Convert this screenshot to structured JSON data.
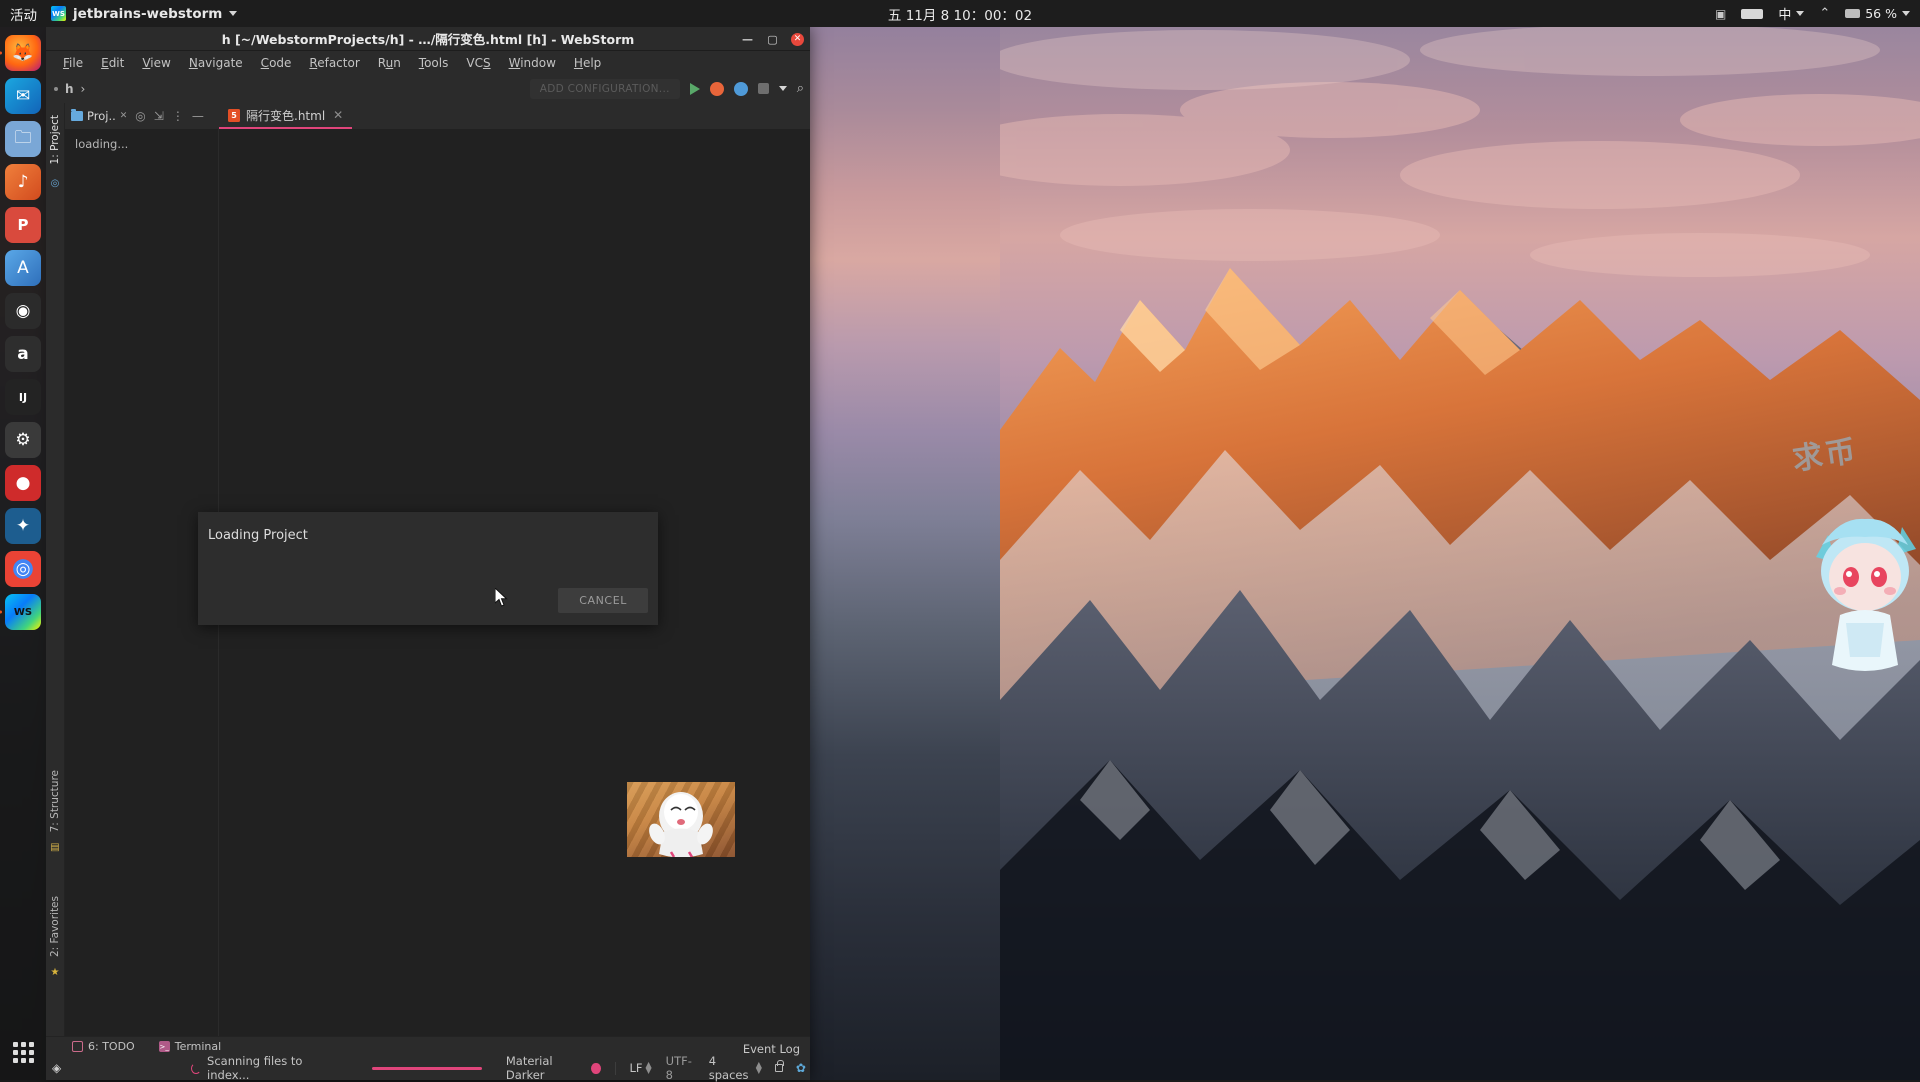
{
  "topbar": {
    "activities": "活动",
    "app_name": "jetbrains-webstorm",
    "app_icon": "webstorm-icon",
    "clock": "五 11月 8  10：00：02",
    "tray": [
      {
        "name": "screencast-icon",
        "glyph": "▣"
      },
      {
        "name": "battery-wide-icon",
        "glyph": "▬"
      },
      {
        "name": "input-method-indicator",
        "label": "中"
      },
      {
        "name": "wifi-icon",
        "glyph": "≋"
      },
      {
        "name": "battery-icon",
        "glyph": "▭"
      }
    ],
    "battery_percent": "56 %"
  },
  "dock": {
    "items": [
      {
        "name": "dock-firefox",
        "label": "Firefox",
        "glyph": "🦊",
        "color": "#ff7139",
        "running": false
      },
      {
        "name": "dock-thunderbird",
        "label": "Thunderbird",
        "glyph": "✉",
        "color": "#3a7bd5",
        "running": false
      },
      {
        "name": "dock-files",
        "label": "Files",
        "glyph": "🗄",
        "color": "#6d9fe0",
        "running": false
      },
      {
        "name": "dock-rhythmbox",
        "label": "Rhythmbox",
        "glyph": "♫",
        "color": "#e8734a",
        "running": false
      },
      {
        "name": "dock-impress",
        "label": "LibreOffice Impress",
        "glyph": "P",
        "color": "#d94a3d",
        "running": false
      },
      {
        "name": "dock-software",
        "label": "Ubuntu Software",
        "glyph": "A",
        "color": "#4a90d9",
        "running": false
      },
      {
        "name": "dock-help",
        "label": "Help",
        "glyph": "◉",
        "color": "#2d2d2d",
        "running": false
      },
      {
        "name": "dock-amazon",
        "label": "Amazon",
        "glyph": "a",
        "color": "#343434",
        "running": false
      },
      {
        "name": "dock-intellij",
        "label": "IntelliJ IDEA",
        "glyph": "IJ",
        "color": "#2b2b2b",
        "running": false
      },
      {
        "name": "dock-settings",
        "label": "Settings",
        "glyph": "⚙",
        "color": "#3c3c3c",
        "running": false
      },
      {
        "name": "dock-record",
        "label": "Recorder",
        "glyph": "●",
        "color": "#d62b2b",
        "running": false
      },
      {
        "name": "dock-vscode",
        "label": "Visual Studio Code",
        "glyph": "✦",
        "color": "#0e639c",
        "running": false
      },
      {
        "name": "dock-chrome",
        "label": "Google Chrome",
        "glyph": "◎",
        "color": "#f2f2f2",
        "running": false
      },
      {
        "name": "dock-webstorm",
        "label": "WebStorm",
        "glyph": "WS",
        "color": "#1c1c1c",
        "running": true
      }
    ]
  },
  "ide": {
    "title": "h [~/WebstormProjects/h] - …/隔行变色.html [h] - WebStorm",
    "window_buttons": {
      "minimize": "—",
      "maximize": "▢",
      "close": "✕"
    },
    "menu": [
      {
        "name": "menu-file",
        "label": "File",
        "mnemonic": "F"
      },
      {
        "name": "menu-edit",
        "label": "Edit",
        "mnemonic": "E"
      },
      {
        "name": "menu-view",
        "label": "View",
        "mnemonic": "V"
      },
      {
        "name": "menu-navigate",
        "label": "Navigate",
        "mnemonic": "N"
      },
      {
        "name": "menu-code",
        "label": "Code",
        "mnemonic": "C"
      },
      {
        "name": "menu-refactor",
        "label": "Refactor",
        "mnemonic": "R"
      },
      {
        "name": "menu-run",
        "label": "Run",
        "mnemonic": "u"
      },
      {
        "name": "menu-tools",
        "label": "Tools",
        "mnemonic": "T"
      },
      {
        "name": "menu-vcs",
        "label": "VCS",
        "mnemonic": "S"
      },
      {
        "name": "menu-window",
        "label": "Window",
        "mnemonic": "W"
      },
      {
        "name": "menu-help",
        "label": "Help",
        "mnemonic": "H"
      }
    ],
    "breadcrumb": "h",
    "breadcrumb_sep": "›",
    "add_configuration": "ADD CONFIGURATION...",
    "toolbar_icons": [
      {
        "name": "run-icon",
        "color": "#59a869"
      },
      {
        "name": "debug-icon",
        "color": "#e8653a"
      },
      {
        "name": "run-coverage-icon",
        "color": "#4f9ad8"
      },
      {
        "name": "stop-icon",
        "color": "#6e6e6e"
      },
      {
        "name": "chevron-down-icon",
        "color": "#b0b0b0"
      },
      {
        "name": "search-everywhere-icon",
        "color": "#b6b6b6"
      }
    ],
    "left_tabs": [
      {
        "name": "sidebar-tab-project",
        "label": "1: Project",
        "active": true
      },
      {
        "name": "sidebar-tab-structure",
        "label": "7: Structure",
        "active": false
      },
      {
        "name": "sidebar-tab-favorites",
        "label": "2: Favorites",
        "active": false
      }
    ],
    "project_panel": {
      "tab_label": "Proj..",
      "tab_close": "✕",
      "actions": [
        {
          "name": "locate-icon",
          "glyph": "◎"
        },
        {
          "name": "collapse-all-icon",
          "glyph": "⇱"
        },
        {
          "name": "options-icon",
          "glyph": "⋮"
        },
        {
          "name": "hide-icon",
          "glyph": "—"
        }
      ],
      "content": "loading..."
    },
    "editor_tabs": [
      {
        "name": "editor-tab-html",
        "label": "隔行变色.html",
        "icon": "html5-icon",
        "icon_label": "5",
        "close": "✕",
        "active": true
      }
    ],
    "dialog": {
      "title": "Loading Project",
      "cancel_label": "CANCEL"
    },
    "bottom_tools": [
      {
        "name": "tool-todo",
        "label": "6: TODO",
        "mnemonic": "6",
        "icon": "todo-icon"
      },
      {
        "name": "tool-terminal",
        "label": "Terminal",
        "icon": "terminal-icon"
      }
    ],
    "status": {
      "layers_icon": "layers-icon",
      "scanning": "Scanning files to index...",
      "event_log": "Event Log",
      "theme": "Material Darker",
      "line_sep": "LF",
      "encoding": "UTF-8",
      "indent": "4 spaces",
      "lock_icon": "lock-icon",
      "config_icon": "gear-icon",
      "accent_color": "#e0457b"
    }
  },
  "desktop": {
    "wallpaper_watermark": "求币",
    "chibi_name": "anime-chibi-character",
    "thumbnail_name": "window-preview-thumbnail"
  }
}
